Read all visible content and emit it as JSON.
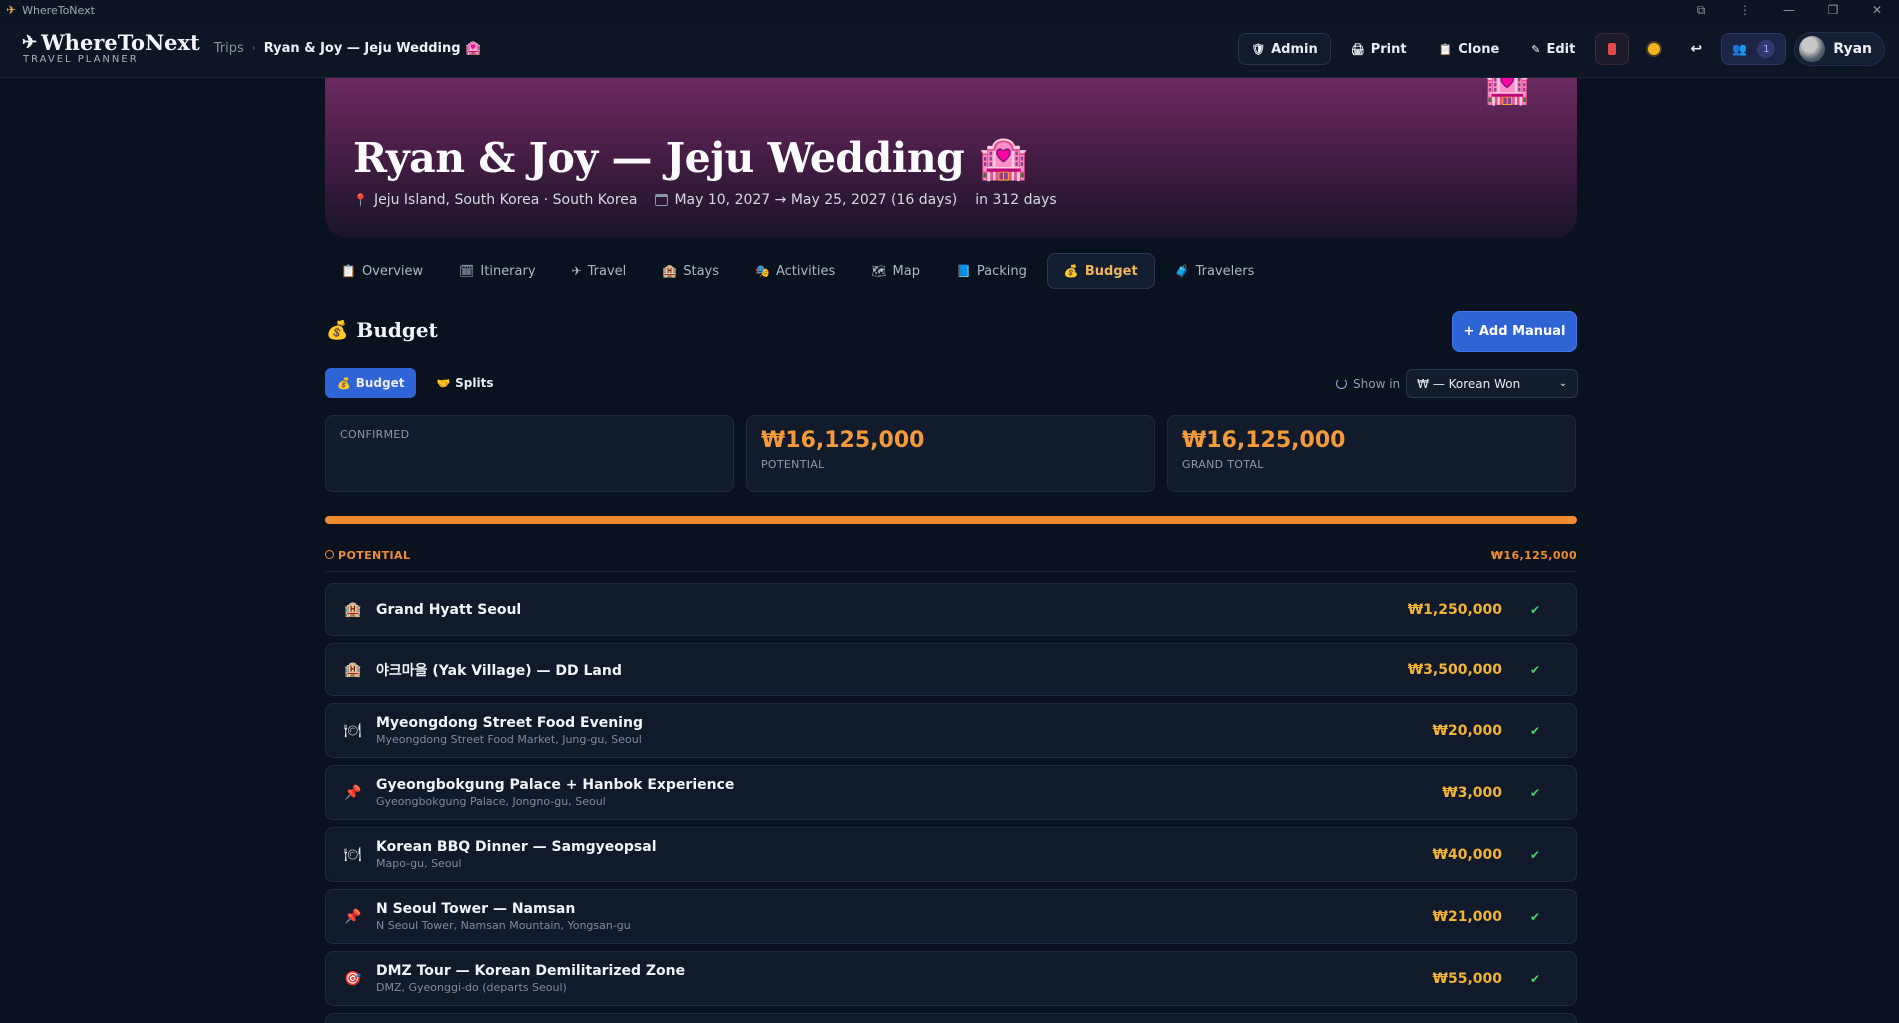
{
  "window": {
    "title": "WhereToNext",
    "controls": [
      "—",
      "❐",
      "✕"
    ]
  },
  "header": {
    "logo_main": "WhereToNext",
    "logo_sub": "TRAVEL PLANNER",
    "breadcrumb_root": "Trips",
    "breadcrumb_current": "Ryan & Joy — Jeju Wedding 🏩",
    "actions": {
      "admin": "Admin",
      "print": "Print",
      "clone": "Clone",
      "edit": "Edit"
    },
    "collaborators_count": "1",
    "user_name": "Ryan"
  },
  "hero": {
    "title": "Ryan & Joy — Jeju Wedding 🏩",
    "location": "Jeju Island, South Korea · South Korea",
    "dates": "May 10, 2027 → May 25, 2027 (16 days)",
    "countdown": "in 312 days",
    "banner_emoji": "🏩"
  },
  "tabs": [
    {
      "icon": "📋",
      "label": "Overview"
    },
    {
      "icon": "🗓",
      "label": "Itinerary"
    },
    {
      "icon": "✈",
      "label": "Travel"
    },
    {
      "icon": "🏨",
      "label": "Stays"
    },
    {
      "icon": "🎭",
      "label": "Activities"
    },
    {
      "icon": "🗺",
      "label": "Map"
    },
    {
      "icon": "📘",
      "label": "Packing"
    },
    {
      "icon": "💰",
      "label": "Budget",
      "active": true
    },
    {
      "icon": "🧳",
      "label": "Travelers"
    }
  ],
  "budget": {
    "title": "Budget",
    "add_button": "+ Add Manual",
    "subtabs": {
      "budget": "Budget",
      "splits": "Splits"
    },
    "show_in_label": "Show in",
    "currency_selected": "₩ — Korean Won",
    "cards": {
      "confirmed_label": "CONFIRMED",
      "potential_value": "₩16,125,000",
      "potential_label": "POTENTIAL",
      "grand_total_value": "₩16,125,000",
      "grand_total_label": "GRAND TOTAL"
    },
    "progress_fraction_potential": 1.0,
    "potential_section": {
      "label": "POTENTIAL",
      "total": "₩16,125,000"
    },
    "items": [
      {
        "icon": "🏨",
        "name": "Grand Hyatt Seoul",
        "sub": "",
        "amount": "₩1,250,000"
      },
      {
        "icon": "🏨",
        "name": "야크마을 (Yak Village) — DD Land",
        "sub": "",
        "amount": "₩3,500,000"
      },
      {
        "icon": "🍽",
        "name": "Myeongdong Street Food Evening",
        "sub": "Myeongdong Street Food Market, Jung-gu, Seoul",
        "amount": "₩20,000"
      },
      {
        "icon": "📌",
        "name": "Gyeongbokgung Palace + Hanbok Experience",
        "sub": "Gyeongbokgung Palace, Jongno-gu, Seoul",
        "amount": "₩3,000"
      },
      {
        "icon": "🍽",
        "name": "Korean BBQ Dinner — Samgyeopsal",
        "sub": "Mapo-gu, Seoul",
        "amount": "₩40,000"
      },
      {
        "icon": "📌",
        "name": "N Seoul Tower — Namsan",
        "sub": "N Seoul Tower, Namsan Mountain, Yongsan-gu",
        "amount": "₩21,000"
      },
      {
        "icon": "🎯",
        "name": "DMZ Tour — Korean Demilitarized Zone",
        "sub": "DMZ, Gyeonggi-do (departs Seoul)",
        "amount": "₩55,000"
      }
    ]
  },
  "colors": {
    "background": "#0a1220",
    "accent_blue": "#2f64d6",
    "potential_orange": "#f28c32",
    "amount_gold": "#f2b332",
    "hero_purple": "#6a2a5e"
  }
}
